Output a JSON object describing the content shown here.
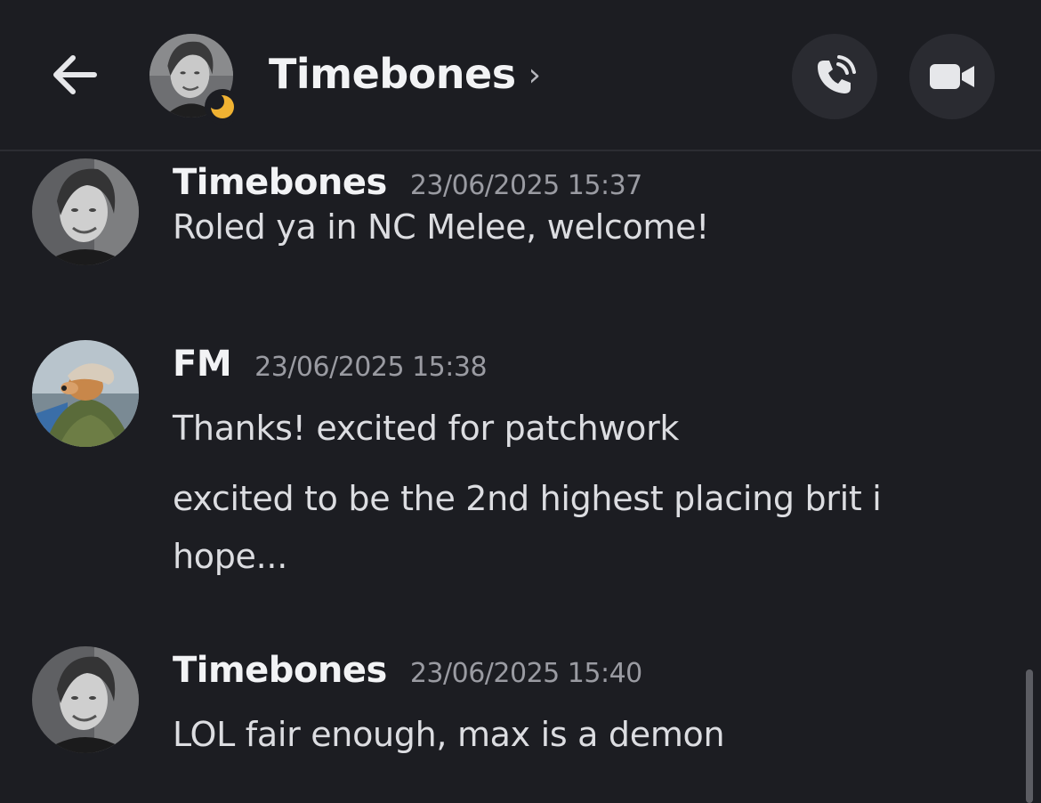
{
  "header": {
    "title": "Timebones",
    "chevron": "›",
    "back_icon": "arrow-left-icon",
    "call_icon": "phone-call-icon",
    "video_icon": "video-camera-icon",
    "status": "idle-moon"
  },
  "messages": [
    {
      "author": "Timebones",
      "timestamp": "23/06/2025 15:37",
      "lines": [
        "Roled ya in NC Melee, welcome!"
      ]
    },
    {
      "author": "FM",
      "timestamp": "23/06/2025 15:38",
      "lines": [
        "Thanks! excited for patchwork",
        "excited to be the 2nd highest placing brit i",
        "hope..."
      ]
    },
    {
      "author": "Timebones",
      "timestamp": "23/06/2025 15:40",
      "lines": [
        "LOL fair enough, max is a demon"
      ]
    }
  ],
  "colors": {
    "background": "#1c1d22",
    "button_bg": "#2a2b31",
    "idle_status": "#f0b232",
    "text_primary": "#f2f3f5",
    "text_secondary": "#9a9ba2"
  }
}
